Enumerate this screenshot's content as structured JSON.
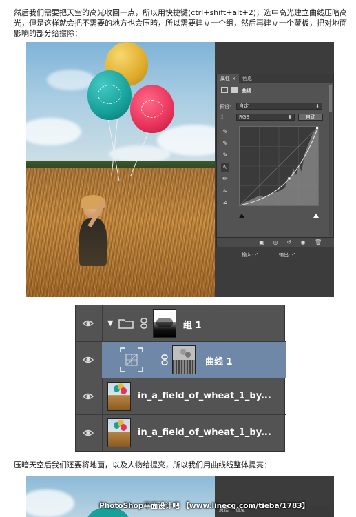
{
  "article": {
    "paragraph1": "然后我们需要把天空的高光收回一点，所以用快捷键(ctrl+shift+alt+2)，选中高光建立曲线压暗高光，但是这样就会把不需要的地方也会压暗，所以需要建立一个组，然后再建立一个蒙板，把对地面影响的部分给擦除：",
    "paragraph2": "压暗天空后我们还要将地面，以及人物给提亮，所以我们用曲线线整体提亮："
  },
  "properties_panel": {
    "tabs": [
      "属性",
      "信息"
    ],
    "title": "曲线",
    "preset_label": "预设:",
    "preset_value": "自定",
    "channel_value": "RGB",
    "auto_button": "自动",
    "input_label": "输入: -1",
    "output_label": "输出: -1",
    "tool_icons": [
      "eyedropper-black-icon",
      "eyedropper-gray-icon",
      "eyedropper-white-icon",
      "curve-point-icon",
      "pencil-icon",
      "smooth-icon",
      "clipping-icon"
    ],
    "footer_icons": [
      "clip-to-layer-icon",
      "view-previous-icon",
      "reset-icon",
      "visibility-icon",
      "trash-icon"
    ]
  },
  "layers_panel": {
    "layers": [
      {
        "name": "组 1",
        "type": "group",
        "selected": false
      },
      {
        "name": "曲线 1",
        "type": "adjustment",
        "selected": true
      },
      {
        "name": "in_a_field_of_wheat_1_by...",
        "type": "image",
        "selected": false
      },
      {
        "name": "in_a_field_of_wheat_1_by...",
        "type": "image",
        "selected": false
      }
    ]
  },
  "screenshot2": {
    "watermark": "PhotoShop平面设计吧 【www.linecg.com/tieba/1783】",
    "tabs": [
      "属性",
      "信息"
    ]
  },
  "colors": {
    "balloon_yellow": "#e8b83a",
    "balloon_teal": "#1aa5a0",
    "balloon_red": "#e8325a",
    "selected_layer": "#7088a8",
    "panel_bg": "#535353"
  }
}
